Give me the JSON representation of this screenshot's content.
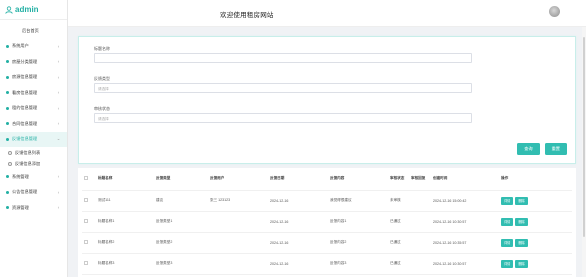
{
  "app": {
    "brand": "admin",
    "title": "欢迎使用租房网站"
  },
  "sidebar": {
    "home": "后台首页",
    "items": [
      {
        "label": "系统用户",
        "has_arrow": true
      },
      {
        "label": "房屋分类管理",
        "has_arrow": true
      },
      {
        "label": "房源信息管理",
        "has_arrow": true
      },
      {
        "label": "看房信息管理",
        "has_arrow": true
      },
      {
        "label": "租约信息管理",
        "has_arrow": true
      },
      {
        "label": "合同信息管理",
        "has_arrow": true
      },
      {
        "label": "反馈信息管理",
        "has_arrow": true,
        "active": true,
        "expanded": true
      }
    ],
    "subitems": [
      {
        "label": "反馈信息列表"
      },
      {
        "label": "反馈信息添加"
      }
    ],
    "items_after": [
      {
        "label": "系统管理",
        "has_arrow": true
      },
      {
        "label": "公告信息管理",
        "has_arrow": true
      },
      {
        "label": "资源管理",
        "has_arrow": true
      }
    ]
  },
  "form": {
    "fields": [
      {
        "label": "标题名称",
        "value": "",
        "placeholder": ""
      },
      {
        "label": "反馈类型",
        "value": "",
        "placeholder": "请选择"
      },
      {
        "label": "审核状态",
        "value": "",
        "placeholder": "请选择"
      }
    ],
    "buttons": {
      "search": "查询",
      "reset": "重置"
    }
  },
  "table": {
    "headers": [
      "",
      "标题名称",
      "反馈类型",
      "反馈用户",
      "反馈日期",
      "反馈内容",
      "审核状态",
      "审核回复",
      "创建时间",
      "操作"
    ],
    "rows": [
      {
        "title": "测试111",
        "type": "建议",
        "user": "张三 123123",
        "date": "2024-12-16",
        "content": "我觉得很建议",
        "status": "未审核",
        "reply": "",
        "created": "2024-12-16 15:00:42"
      },
      {
        "title": "标题名称1",
        "type": "反馈类型1",
        "user": "",
        "date": "2024-12-16",
        "content": "反馈内容1",
        "status": "已通过",
        "reply": "",
        "created": "2024-12-16 10:30:57"
      },
      {
        "title": "标题名称2",
        "type": "反馈类型2",
        "user": "",
        "date": "2024-12-16",
        "content": "反馈内容2",
        "status": "已通过",
        "reply": "",
        "created": "2024-12-16 10:35:57"
      },
      {
        "title": "标题名称3",
        "type": "反馈类型3",
        "user": "",
        "date": "2024-12-16",
        "content": "反馈内容3",
        "status": "已通过",
        "reply": "",
        "created": "2024-12-16 10:30:57"
      }
    ],
    "action_labels": {
      "edit": "详情",
      "delete": "删除"
    }
  },
  "colors": {
    "accent": "#31bdb1",
    "brand": "#23b0a4",
    "page_bg": "#f0f2f5"
  }
}
